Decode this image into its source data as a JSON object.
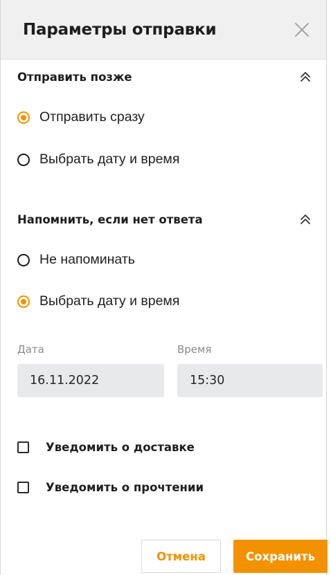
{
  "header": {
    "title": "Параметры отправки"
  },
  "send_later": {
    "title": "Отправить позже",
    "options": [
      {
        "label": "Отправить сразу",
        "checked": true
      },
      {
        "label": "Выбрать дату и время",
        "checked": false
      }
    ]
  },
  "remind": {
    "title": "Напомнить, если нет ответа",
    "options": [
      {
        "label": "Не напоминать",
        "checked": false
      },
      {
        "label": "Выбрать дату и время",
        "checked": true
      }
    ],
    "date_label": "Дата",
    "date_value": "16.11.2022",
    "time_label": "Время",
    "time_value": "15:30"
  },
  "notifications": {
    "delivery": {
      "label": "Уведомить о доставке",
      "checked": false
    },
    "read": {
      "label": "Уведомить о прочтении",
      "checked": false
    }
  },
  "actions": {
    "cancel_label": "Отмена",
    "save_label": "Сохранить"
  },
  "colors": {
    "accent": "#f39200",
    "header_bg": "#f0f0f0",
    "field_bg": "#e8e9eb"
  },
  "icons": {
    "close": "close-icon",
    "collapse": "chevron-double-up-icon"
  }
}
